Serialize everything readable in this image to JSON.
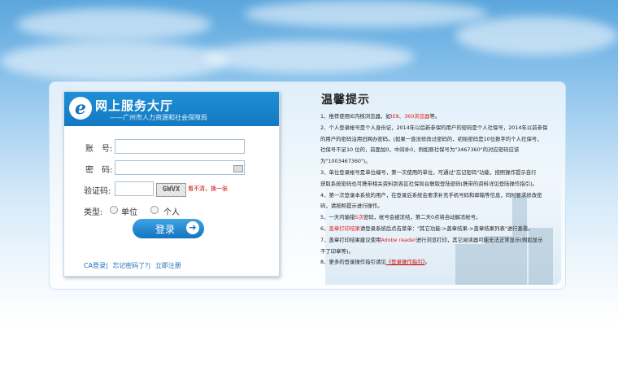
{
  "header": {
    "site_title": "网上服务大厅",
    "site_subtitle": "——广州市人力资源和社会保障局"
  },
  "login": {
    "account_label": "账　号:",
    "account_value": "",
    "password_label": "密　码:",
    "password_value": "",
    "captcha_label": "验证码:",
    "captcha_value": "",
    "captcha_image_text": "GWVX",
    "captcha_refresh": "看不清，换一张",
    "type_label": "类型:",
    "type_options": [
      "单位",
      "个人"
    ],
    "login_button": "登录",
    "links": [
      "CA登录|",
      "忘记密码了?|",
      "立即注册"
    ]
  },
  "tips": {
    "title": "温馨提示",
    "lines": [
      {
        "a": "1、推荐使用IE内核浏览器，如",
        "b": "IE8、360浏览器",
        "c": "等。"
      },
      {
        "a": "2、个人登录帐号是个人身份证，2014年以后新参保的用户的密码是个人社保号，2014年以前参保"
      },
      {
        "a": "的用户的密码沿用旧网办密码。(如果一直没修改过密码的，初始密码是10位数字的个人社保号，"
      },
      {
        "a": "社保号不足10 位的，前面加0，中间补0，例如原社保号为\"3467360\"的对应密码应该"
      },
      {
        "a": "为\"1003467360\")。"
      },
      {
        "a": "3、单位登录帐号是单位编号，第一次使用的单位，可通过\"忘记密码\"功能，按照操作提示自行"
      },
      {
        "a": "获取系统密码也可携带相关资料到各区社保局台联取登陆密码(携带的资料详见登陆操作指引)。"
      },
      {
        "a": "4、第一次登录本系统的用户，在登录后系统会要求补充手机号码和邮箱等信息，同时要求修改密"
      },
      {
        "a": "码，请按照提示进行操作。"
      },
      {
        "a": "5、一天内输错",
        "b": "5次",
        "c": "密码，帐号会被冻结，第二天0点将自动解冻帐号。"
      },
      {
        "a": "6、",
        "b": "盖章打印结果",
        "c": "请登录系统后点击菜单：\"其它功能->盖章结果->盖章结果列表\"进行查看。"
      },
      {
        "a": "7、盖章打印结果建议使用",
        "b": "Adobe reader",
        "c": "进行浏览打印，其它阅读器可能无法正常显示(例如显示"
      },
      {
        "a": "不了印章等)。"
      },
      {
        "a": "8、更多的登录操作指引请见",
        "link": "《登录操作指引》",
        "c": "。"
      }
    ]
  }
}
